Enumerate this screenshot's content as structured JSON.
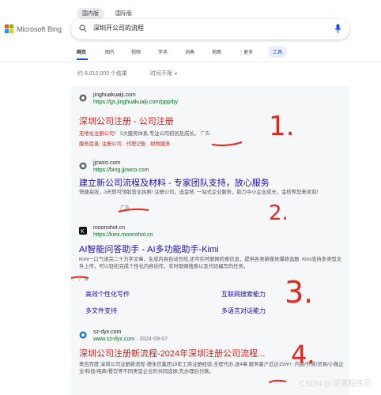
{
  "region_tabs": [
    "国内版",
    "国际版"
  ],
  "logo": {
    "text": "Microsoft Bing",
    "colors": [
      "#f25022",
      "#7fba00",
      "#00a4ef",
      "#ffb900"
    ]
  },
  "search": {
    "query": "深圳开公司的流程"
  },
  "nav": {
    "items": [
      "网页",
      "图片",
      "视频",
      "学术",
      "词典",
      "地图",
      "更多"
    ],
    "tools": "工具"
  },
  "results_meta": {
    "count": "约 8,610,000 个结果",
    "time_filter": "时间不限"
  },
  "results": [
    {
      "site": "jinghuakuaiji.com",
      "url": "https://gs.jinghuakuaiji.com/ppp/by",
      "title": "深圳公司注册 - 公司注册",
      "snippet_lead": "无地址注册公司！",
      "snippet_rest": "5大服务体系,专注公司初创及成长。",
      "ad": "广告",
      "links_label": "服务目录:",
      "links": [
        "注册公司",
        "代理记账",
        "财税服务"
      ],
      "annotation": "1."
    },
    {
      "site": "jjcwco.com",
      "url": "https://bing.jjcwco.com",
      "title": "建立新公司流程及材料 - 专家团队支持，放心服务",
      "snippet": "快捷高效，3天即可领取营业执照! 注册公司，选金桔. 一站式企业服务，助力中小企业成长，金桔等您来咨询！",
      "ad": "广告",
      "annotation": "2."
    },
    {
      "site": "moonshot.cn",
      "url": "https://kimi.moonshot.cn",
      "title": "AI智能问答助手 - AI多功能助手-Kimi",
      "snippet": "Kimi一口气读完二十万字文章，生成内容自动总结,还可实时联网检索信息，提供各类新媒体爆款选题. Kimi支持多类型文件上传，可以轻松完成个性化内容创作，实时联网搜索以及代码编写的任务。",
      "ad": "广告",
      "sublinks": [
        "高效个性化写作",
        "互联网搜索能力",
        "多文件支持",
        "多语言对话能力"
      ],
      "annotation": "3."
    },
    {
      "site": "sz-dyx.com",
      "url": "www.sz-dyx.com",
      "date": "· 2024-09-07",
      "title": "深圳公司注册新流程-2024年深圳注册公司流程...",
      "snippet": "来自百度 深圳公司注册新流程-德永信集团19年工商注册经验,全程代办,送4章,服务客户近达15W+. 内资/外资/贸易/小微企业/科技/电商/餐饮等不同类型企业的共同选择,先办理后付款。",
      "annotation": "4."
    }
  ],
  "watermark": "CSDN @深漂程序员"
}
